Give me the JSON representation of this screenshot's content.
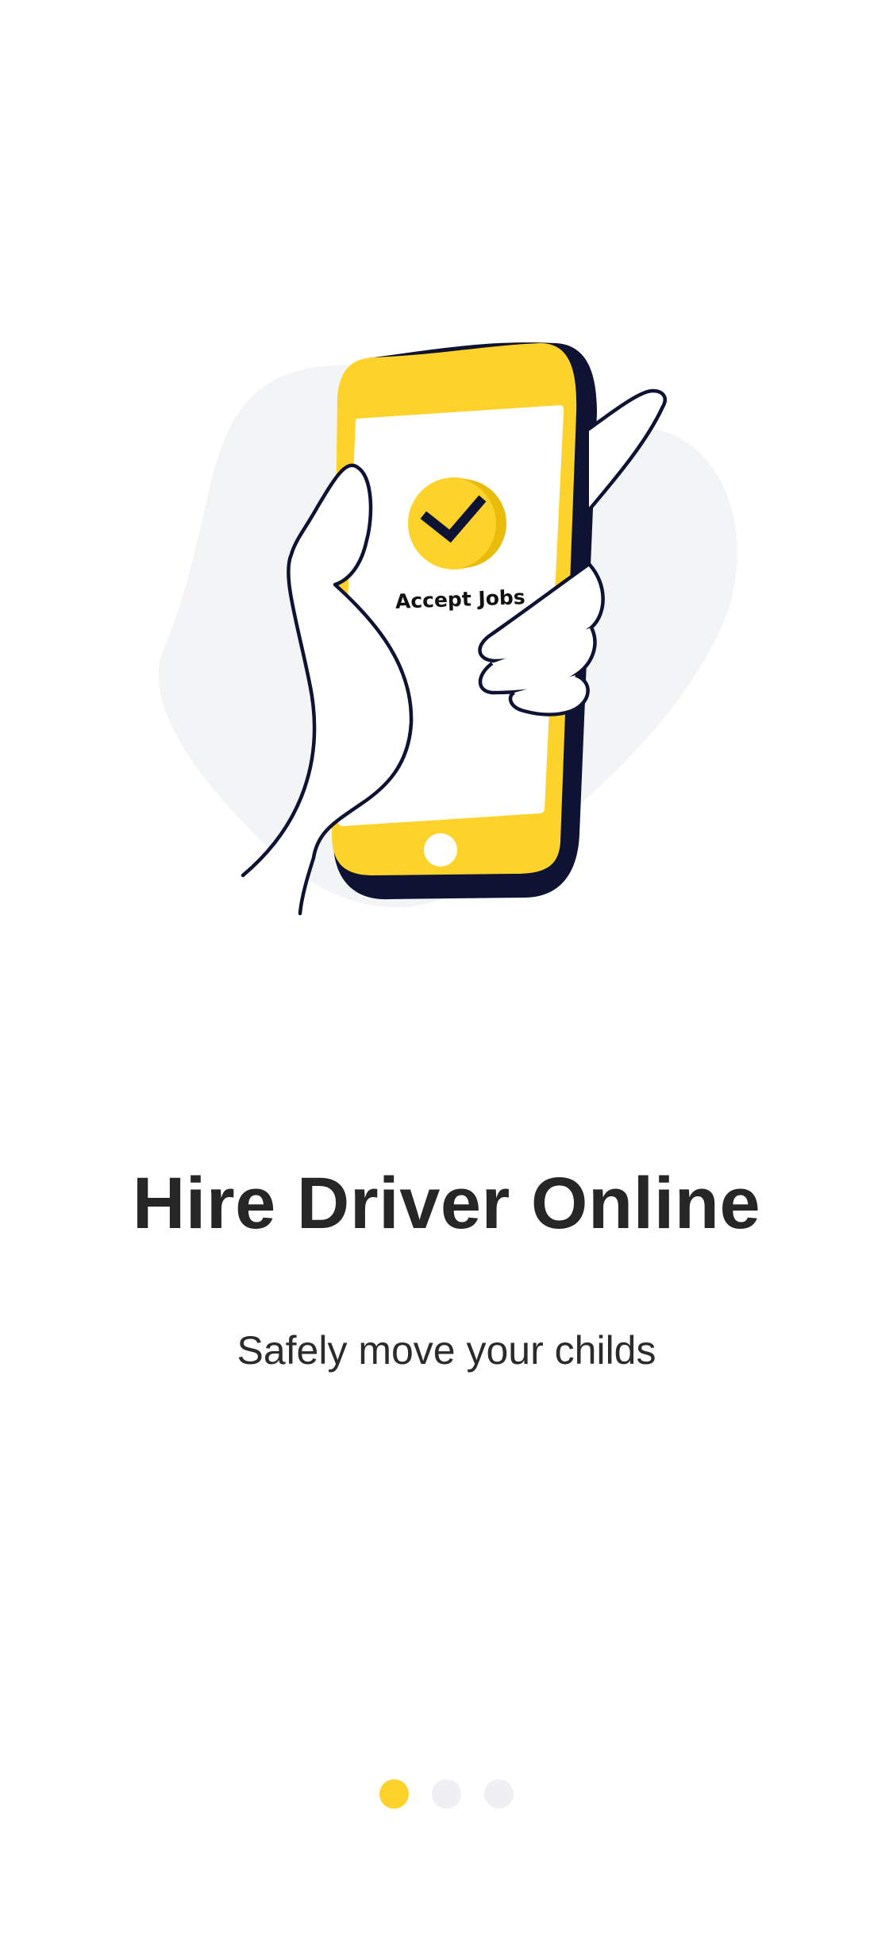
{
  "illustration": {
    "screen_label": "Accept Jobs",
    "icon": "check-circle-icon"
  },
  "onboarding": {
    "title": "Hire Driver Online",
    "subtitle": "Safely move your childs"
  },
  "pager": {
    "total": 3,
    "active_index": 0
  },
  "colors": {
    "accent": "#FDD22B",
    "phone_shadow": "#0E1333",
    "blob": "#F3F4F6",
    "title": "#262626",
    "inactive_dot": "#F0F0F2"
  }
}
